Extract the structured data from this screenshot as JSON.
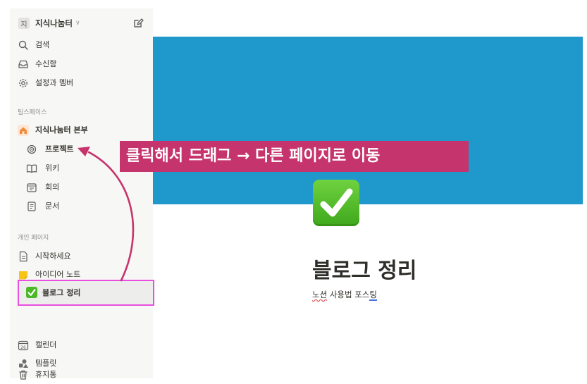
{
  "sidebar": {
    "workspace": {
      "avatar": "지",
      "name": "지식나눔터",
      "chevron": "∨"
    },
    "top_items": [
      {
        "icon": "search-icon",
        "label": "검색"
      },
      {
        "icon": "inbox-icon",
        "label": "수신함"
      },
      {
        "icon": "gear-icon",
        "label": "설정과 멤버"
      }
    ],
    "teamspace_title": "팀스페이스",
    "teamspace_root": {
      "icon": "home-icon",
      "label": "지식나눔터 본부"
    },
    "teamspace_items": [
      {
        "icon": "target-icon",
        "label": "프로젝트"
      },
      {
        "icon": "book-icon",
        "label": "위키"
      },
      {
        "icon": "calendar-note-icon",
        "label": "회의"
      },
      {
        "icon": "document-icon",
        "label": "문서"
      }
    ],
    "private_title": "개인 페이지",
    "private_items": [
      {
        "icon": "page-icon",
        "label": "시작하세요"
      },
      {
        "icon": "sticky-note-icon",
        "label": "아이디어 노트"
      },
      {
        "icon": "check-box-icon",
        "label": "블로그 정리"
      }
    ],
    "bottom_items": [
      {
        "icon": "calendar-icon",
        "label": "캘린더",
        "badge": "26"
      },
      {
        "icon": "shapes-icon",
        "label": "템플릿"
      },
      {
        "icon": "trash-icon",
        "label": "휴지통"
      }
    ]
  },
  "page": {
    "cover_color": "#1f98cc",
    "icon": "check-mark-icon",
    "title": "블로그 정리",
    "subtitle_part1": "노션",
    "subtitle_part2": " 사용법 포스",
    "subtitle_part3": "팅"
  },
  "annotation": {
    "banner_text": "클릭해서 드래그 → 다른 페이지로 이동",
    "banner_color": "#c6346d",
    "highlight_color": "#e94ee0"
  }
}
